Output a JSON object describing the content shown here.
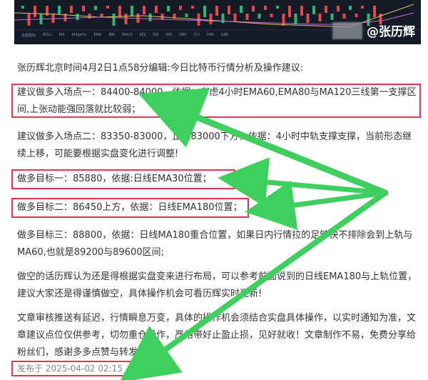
{
  "watermark": {
    "author": "@张历辉"
  },
  "chart_toolbar": [
    "全部指标",
    "BOLL",
    "MA",
    "Alligator",
    "EMA",
    "BBI",
    "MACD",
    "KDJ",
    "RSI",
    "WR",
    "OBV",
    "CCI",
    "DMI",
    "SAR"
  ],
  "article": {
    "intro": "张历辉北京时间4月2日1点58分编辑:今日比特币行情分析及操作建议:",
    "long_entry_1": "建议做多入场点一：84400-84000，依据：考虑4小时EMA60,EMA80与MA120三线第一支撑区间,上张动能强回落就比较弱；",
    "long_entry_2": "建议做多入场点二：83350-83000，止损83000下方，依据：4小时中轨支撑支撑，当前形态继续上移，可能要根据实盘变化进行调整!",
    "target_1": "做多目标一：85880，依据:日线EMA30位置；",
    "target_2": "做多目标二：86450上方，依据：日线EMA180位置；",
    "target_3": "做多目标三：88800，依据：日线MA180重合位置，如果日内行情拉的足够快不排除会到上轨与MA60,也就是89200与89600区间;",
    "short_note": "做空的话历辉认为还是得根据实盘变来进行布局，可以参考前面说到的日线EMA180与上轨位置，建议大家还是得谨慎做空，具体操作机会可看历辉实时更新!",
    "disclaimer": "文章审核推送有延迟，行情瞬息万变，具体的操作机会须结合实盘具体操作，以实时通知为准，文章建议点位仅供参考，切勿重仓操作，严格带好止盈止损，见好就收！文章制作不易，免费分享给粉丝们，感谢多多点赞与转发支持!",
    "published": "发布于 2025-04-02 02:15"
  },
  "colors": {
    "highlight_border": "#e8344b",
    "arrow": "#3ecf5e",
    "text": "#333333",
    "meta": "#888888"
  }
}
